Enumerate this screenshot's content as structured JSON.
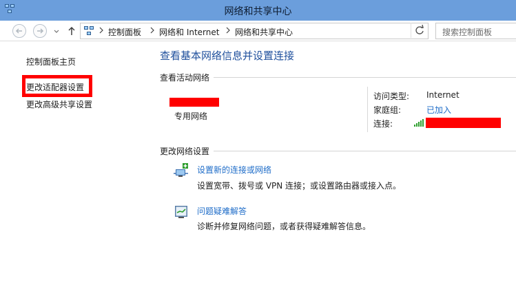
{
  "window": {
    "title": "网络和共享中心"
  },
  "addressbar": {
    "crumbs": [
      "控制面板",
      "网络和 Internet",
      "网络和共享中心"
    ],
    "search_placeholder": "搜索控制面板"
  },
  "sidebar": {
    "items": [
      {
        "label": "控制面板主页"
      },
      {
        "label": "更改适配器设置"
      },
      {
        "label": "更改高级共享设置"
      }
    ]
  },
  "main": {
    "title": "查看基本网络信息并设置连接",
    "active_networks_label": "查看活动网络",
    "network_type": "专用网络",
    "details": {
      "access_type_label": "访问类型:",
      "access_type_value": "Internet",
      "homegroup_label": "家庭组:",
      "homegroup_value": "已加入",
      "connection_label": "连接:"
    },
    "change_settings_label": "更改网络设置",
    "tasks": [
      {
        "icon": "new-connection-icon",
        "title": "设置新的连接或网络",
        "description": "设置宽带、拨号或 VPN 连接；或设置路由器或接入点。"
      },
      {
        "icon": "troubleshoot-icon",
        "title": "问题疑难解答",
        "description": "诊断并修复网络问题，或者获得疑难解答信息。"
      }
    ]
  },
  "colors": {
    "titlebar": "#6b9edc",
    "link": "#1e6cc8",
    "heading": "#1e4f9c",
    "highlight": "#ff0000"
  }
}
